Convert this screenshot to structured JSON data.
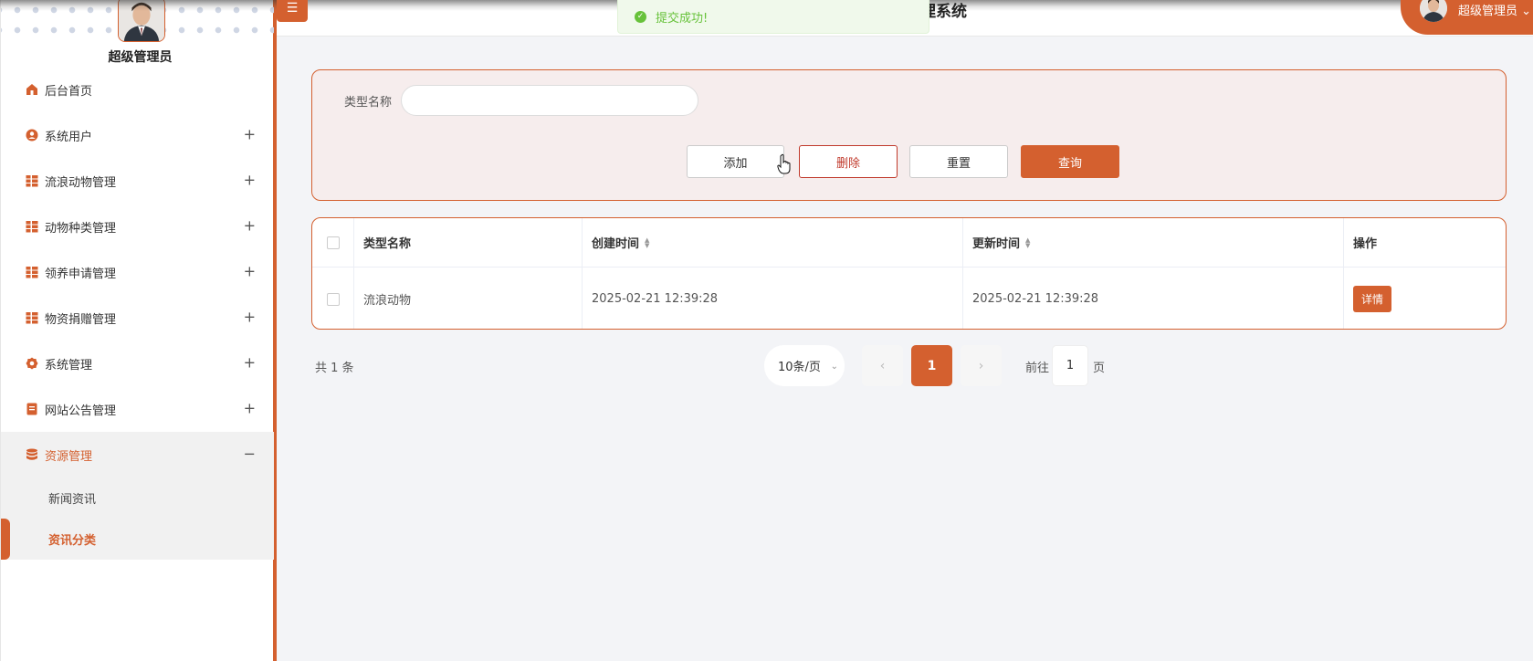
{
  "header": {
    "title": "理系统",
    "user_name": "超级管理员"
  },
  "toast": {
    "message": "提交成功!"
  },
  "sidebar": {
    "admin_name": "超级管理员",
    "items": [
      {
        "label": "后台首页",
        "icon": "home-icon",
        "expandable": false
      },
      {
        "label": "系统用户",
        "icon": "user-icon",
        "expandable": true
      },
      {
        "label": "流浪动物管理",
        "icon": "grid-icon",
        "expandable": true
      },
      {
        "label": "动物种类管理",
        "icon": "grid-icon",
        "expandable": true
      },
      {
        "label": "领养申请管理",
        "icon": "grid-icon",
        "expandable": true
      },
      {
        "label": "物资捐赠管理",
        "icon": "grid-icon",
        "expandable": true
      },
      {
        "label": "系统管理",
        "icon": "gear-icon",
        "expandable": true
      },
      {
        "label": "网站公告管理",
        "icon": "document-icon",
        "expandable": true
      },
      {
        "label": "资源管理",
        "icon": "database-icon",
        "expandable": true,
        "expanded": true
      }
    ],
    "plus": "+",
    "minus": "−",
    "subitems": [
      {
        "label": "新闻资讯",
        "active": false
      },
      {
        "label": "资讯分类",
        "active": true
      }
    ]
  },
  "search": {
    "label": "类型名称",
    "value": "",
    "buttons": {
      "add": "添加",
      "delete": "删除",
      "reset": "重置",
      "query": "查询"
    }
  },
  "table": {
    "columns": [
      "类型名称",
      "创建时间",
      "更新时间",
      "操作"
    ],
    "rows": [
      {
        "name": "流浪动物",
        "created": "2025-02-21 12:39:28",
        "updated": "2025-02-21 12:39:28",
        "action": "详情"
      }
    ]
  },
  "pagination": {
    "total": "共 1 条",
    "page_size": "10条/页",
    "current_page": "1",
    "goto_prefix": "前往",
    "goto_value": "1",
    "goto_suffix": "页"
  },
  "colors": {
    "accent": "#d4602f",
    "success": "#67c23a",
    "danger": "#c0392b"
  }
}
